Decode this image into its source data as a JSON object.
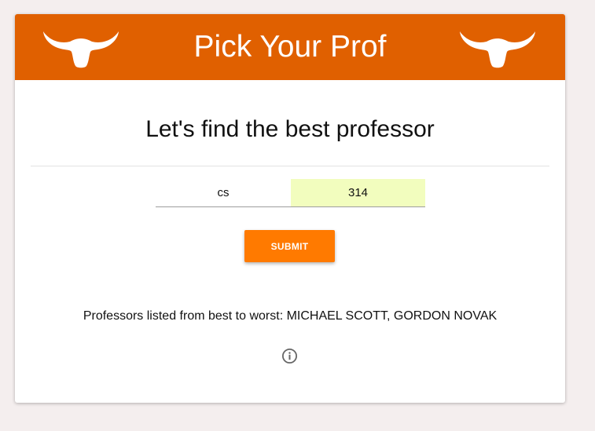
{
  "header": {
    "title": "Pick Your Prof",
    "logo_left": "longhorn-logo",
    "logo_right": "longhorn-logo",
    "color": "#e06000"
  },
  "main": {
    "headline": "Let's find the best professor",
    "department_input": {
      "value": "cs"
    },
    "course_input": {
      "value": "314"
    },
    "submit_label": "SUBMIT",
    "submit_color": "#ff7a00",
    "result_text": "Professors listed from best to worst: MICHAEL SCOTT, GORDON NOVAK",
    "info_icon": "info-circle-icon"
  }
}
